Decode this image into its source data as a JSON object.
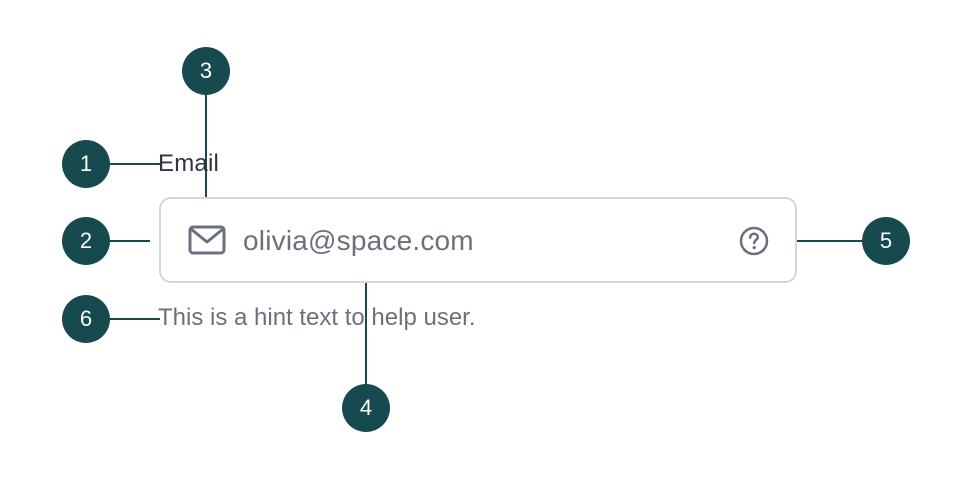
{
  "field": {
    "label": "Email",
    "value": "olivia@space.com",
    "hint": "This is a hint text to help user."
  },
  "icons": {
    "leading": "mail-icon",
    "trailing": "help-circle-icon"
  },
  "callouts": [
    "1",
    "2",
    "3",
    "4",
    "5",
    "6"
  ],
  "colors": {
    "marker_fill": "#164a4f",
    "marker_text": "#ffffff",
    "label_text": "#2f3440",
    "value_text": "#6b717c",
    "hint_text": "#6b717c",
    "input_border": "#d3d6db",
    "icon_stroke": "#6b717c"
  }
}
